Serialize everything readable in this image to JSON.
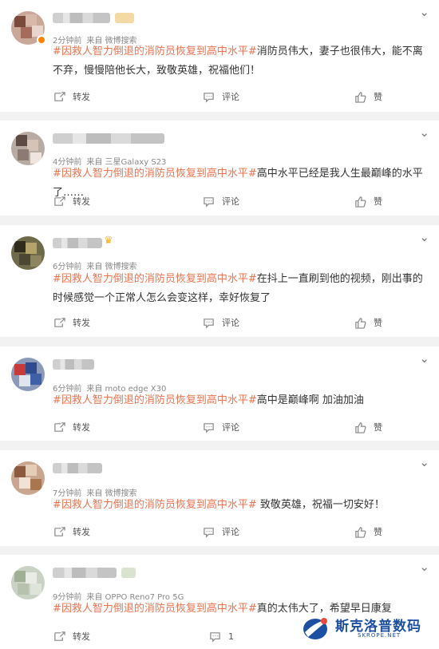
{
  "icons": {
    "repost": "repost-icon",
    "comment": "comment-icon",
    "like": "like-icon",
    "more": "chevron-down-icon"
  },
  "colors": {
    "hashtag": "#eb7350",
    "verified_badge": "#ff8200",
    "watermark": "#1d4fa3"
  },
  "posts": [
    {
      "time": "2分钟前",
      "source": "来自 微博搜索",
      "hashtag": "#因救人智力倒退的消防员恢复到高中水平#",
      "text": "消防员伟大，妻子也很伟大，能不离不弃，慢慢陪他长大，致敬英雄，祝福他们！",
      "repost": "转发",
      "comment": "评论",
      "like": "赞"
    },
    {
      "time": "4分钟前",
      "source": "来自 三星Galaxy S23",
      "hashtag": "#因救人智力倒退的消防员恢复到高中水平#",
      "text": "高中水平已经是我人生最巅峰的水平了……",
      "repost": "转发",
      "comment": "评论",
      "like": "赞"
    },
    {
      "time": "6分钟前",
      "source": "来自 微博搜索",
      "hashtag": "#因救人智力倒退的消防员恢复到高中水平#",
      "text": "在抖上一直刷到他的视频，刚出事的时候感觉一个正常人怎么会变这样，幸好恢复了",
      "repost": "转发",
      "comment": "评论",
      "like": "赞"
    },
    {
      "time": "6分钟前",
      "source": "来自 moto edge X30",
      "hashtag": "#因救人智力倒退的消防员恢复到高中水平#",
      "text": "高中是巅峰啊 加油加油",
      "repost": "转发",
      "comment": "评论",
      "like": "赞"
    },
    {
      "time": "7分钟前",
      "source": "来自 微博搜索",
      "hashtag": "#因救人智力倒退的消防员恢复到高中水平#",
      "text": " 致敬英雄，祝福一切安好！",
      "repost": "转发",
      "comment": "评论",
      "like": "赞"
    },
    {
      "time": "9分钟前",
      "source": "来自 OPPO Reno7 Pro 5G",
      "hashtag": "#因救人智力倒退的消防员恢复到高中水平#",
      "text": "真的太伟大了，希望早日康复",
      "repost": "转发",
      "comment": "1",
      "like": ""
    }
  ],
  "watermark": {
    "text": "斯克洛普数码",
    "sub": "SKROPE.NET"
  }
}
